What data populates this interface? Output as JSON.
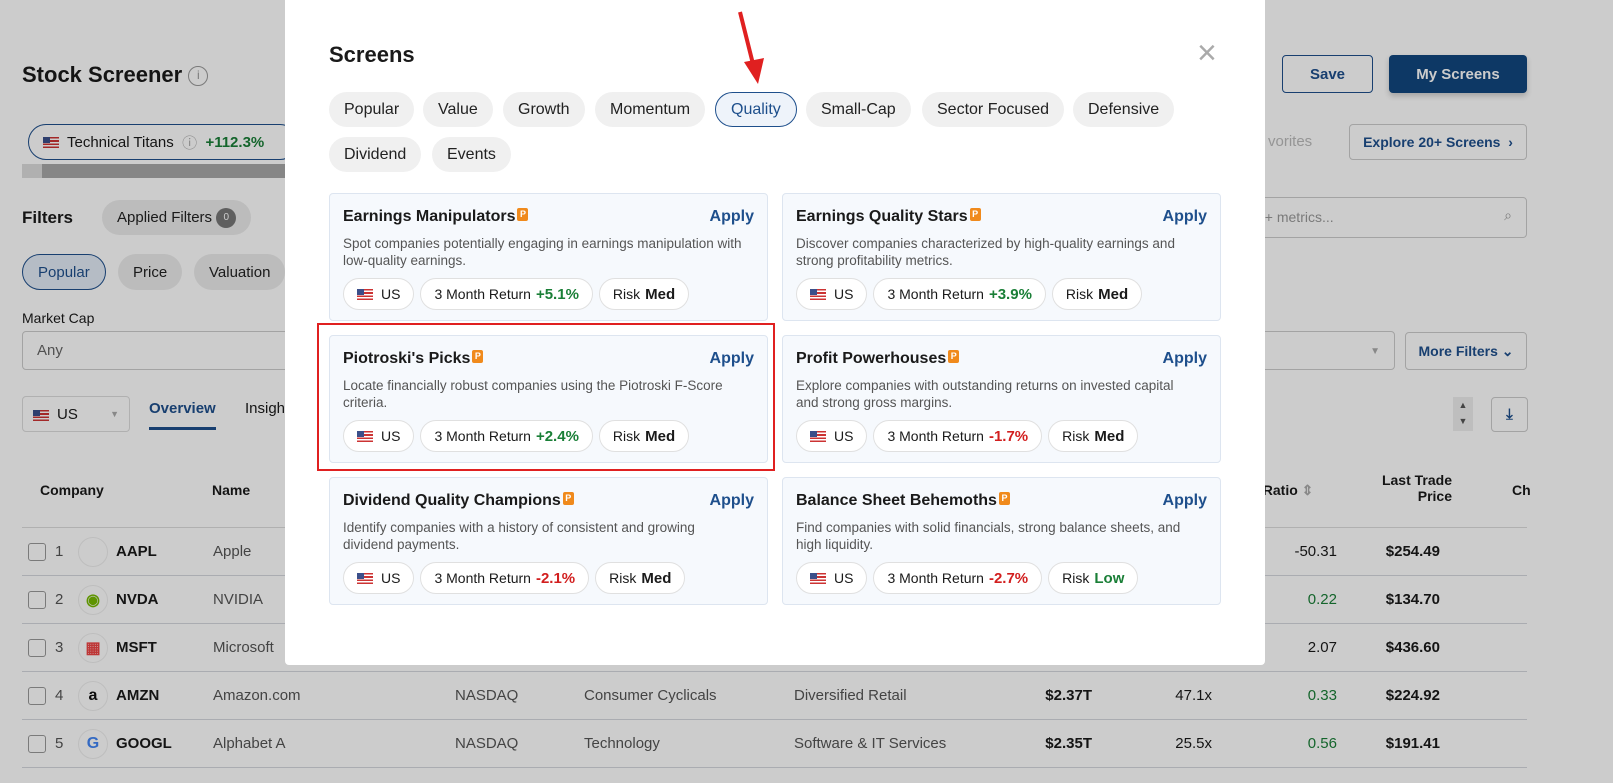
{
  "page": {
    "title": "Stock Screener",
    "save": "Save",
    "my_screens": "My Screens",
    "explore": "Explore 20+ Screens",
    "favorites_partial": "vorites",
    "screen_chip": {
      "name": "Technical Titans",
      "return": "+112.3%"
    },
    "filters_label": "Filters",
    "applied_filters": "Applied Filters",
    "applied_count": "0",
    "filter_tabs": [
      "Popular",
      "Price",
      "Valuation"
    ],
    "search_placeholder_partial": "0+ metrics...",
    "market_cap_label": "Market Cap",
    "market_cap_value": "Any",
    "more_filters": "More Filters",
    "region": "US",
    "view_tabs": [
      "Overview",
      "Insigh"
    ],
    "columns": {
      "company": "Company",
      "name": "Name",
      "peg": "G Ratio",
      "price": "Last Trade Price",
      "change": "Ch"
    },
    "rows": [
      {
        "n": "1",
        "ticker": "AAPL",
        "name": "Apple",
        "exchange": "",
        "sector": "",
        "industry": "",
        "mcap": "",
        "pe": "",
        "peg": "-50.31",
        "peg_color": "#1a1a1a",
        "price": "$254.49"
      },
      {
        "n": "2",
        "ticker": "NVDA",
        "name": "NVIDIA",
        "exchange": "",
        "sector": "",
        "industry": "",
        "mcap": "",
        "pe": "",
        "peg": "0.22",
        "peg_color": "#1a7f37",
        "price": "$134.70"
      },
      {
        "n": "3",
        "ticker": "MSFT",
        "name": "Microsoft",
        "exchange": "",
        "sector": "",
        "industry": "",
        "mcap": "",
        "pe": "",
        "peg": "2.07",
        "peg_color": "#1a1a1a",
        "price": "$436.60"
      },
      {
        "n": "4",
        "ticker": "AMZN",
        "name": "Amazon.com",
        "exchange": "NASDAQ",
        "sector": "Consumer Cyclicals",
        "industry": "Diversified Retail",
        "mcap": "$2.37T",
        "pe": "47.1x",
        "peg": "0.33",
        "peg_color": "#1a7f37",
        "price": "$224.92"
      },
      {
        "n": "5",
        "ticker": "GOOGL",
        "name": "Alphabet A",
        "exchange": "NASDAQ",
        "sector": "Technology",
        "industry": "Software & IT Services",
        "mcap": "$2.35T",
        "pe": "25.5x",
        "peg": "0.56",
        "peg_color": "#1a7f37",
        "price": "$191.41"
      }
    ]
  },
  "modal": {
    "title": "Screens",
    "tabs": [
      "Popular",
      "Value",
      "Growth",
      "Momentum",
      "Quality",
      "Small-Cap",
      "Sector Focused",
      "Defensive",
      "Dividend",
      "Events"
    ],
    "active_tab": "Quality",
    "apply": "Apply",
    "region": "US",
    "return_label": "3 Month Return",
    "risk_label": "Risk",
    "cards": [
      {
        "title": "Earnings Manipulators",
        "desc": "Spot companies potentially engaging in earnings manipulation with low-quality earnings.",
        "ret": "+5.1%",
        "risk": "Med"
      },
      {
        "title": "Earnings Quality Stars",
        "desc": "Discover companies characterized by high-quality earnings and strong profitability metrics.",
        "ret": "+3.9%",
        "risk": "Med"
      },
      {
        "title": "Piotroski's Picks",
        "desc": "Locate financially robust companies using the Piotroski F-Score criteria.",
        "ret": "+2.4%",
        "risk": "Med"
      },
      {
        "title": "Profit Powerhouses",
        "desc": "Explore companies with outstanding returns on invested capital and strong gross margins.",
        "ret": "-1.7%",
        "risk": "Med"
      },
      {
        "title": "Dividend Quality Champions",
        "desc": "Identify companies with a history of consistent and growing dividend payments.",
        "ret": "-2.1%",
        "risk": "Med"
      },
      {
        "title": "Balance Sheet Behemoths",
        "desc": "Find companies with solid financials, strong balance sheets, and high liquidity.",
        "ret": "-2.7%",
        "risk": "Low"
      }
    ]
  },
  "colors": {
    "brand": "#1e4f8c",
    "positive": "#1a7f37",
    "negative": "#d21f1f",
    "highlight": "#e02020"
  }
}
